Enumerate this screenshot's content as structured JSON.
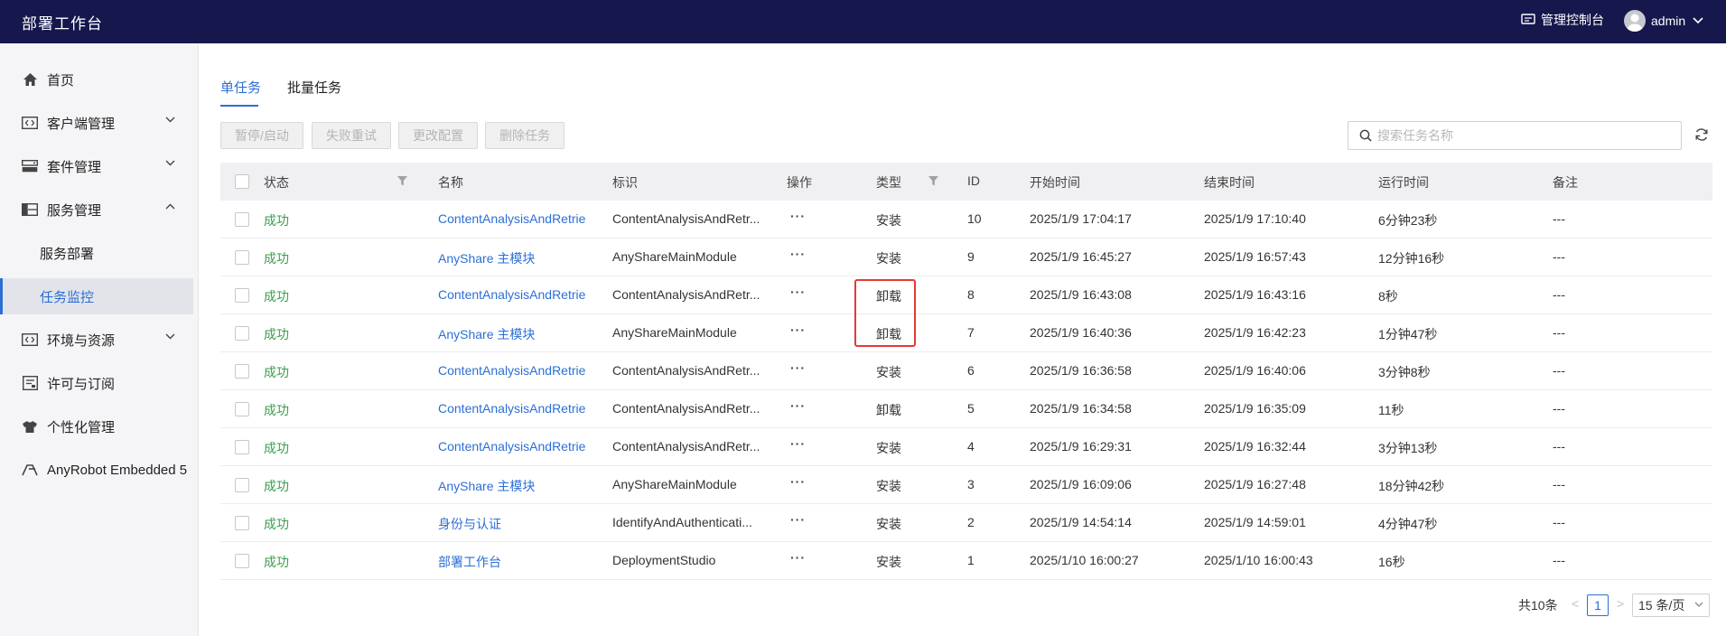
{
  "app": {
    "title": "部署工作台"
  },
  "header": {
    "console_label": "管理控制台",
    "user_name": "admin"
  },
  "sidebar": {
    "items": [
      {
        "label": "首页",
        "icon": "home-icon"
      },
      {
        "label": "客户端管理",
        "icon": "code-icon"
      },
      {
        "label": "套件管理",
        "icon": "server-icon"
      },
      {
        "label": "服务管理",
        "icon": "grid-icon"
      },
      {
        "label": "服务部署"
      },
      {
        "label": "任务监控"
      },
      {
        "label": "环境与资源",
        "icon": "code-icon"
      },
      {
        "label": "许可与订阅",
        "icon": "license-icon"
      },
      {
        "label": "个性化管理",
        "icon": "shirt-icon"
      },
      {
        "label": "AnyRobot Embedded 5",
        "icon": "anyrobot-icon"
      }
    ]
  },
  "tabs": [
    {
      "label": "单任务"
    },
    {
      "label": "批量任务"
    }
  ],
  "toolbar": {
    "pause_label": "暂停/启动",
    "retry_label": "失败重试",
    "change_label": "更改配置",
    "delete_label": "删除任务"
  },
  "search": {
    "placeholder": "搜索任务名称"
  },
  "table": {
    "headers": {
      "status": "状态",
      "name": "名称",
      "tag": "标识",
      "op": "操作",
      "type": "类型",
      "id": "ID",
      "start": "开始时间",
      "end": "结束时间",
      "duration": "运行时间",
      "note": "备注"
    },
    "rows": [
      {
        "status": "成功",
        "name": "ContentAnalysisAndRetrie",
        "tag": "ContentAnalysisAndRetr...",
        "op": "···",
        "type": "安装",
        "id": "10",
        "start": "2025/1/9 17:04:17",
        "end": "2025/1/9 17:10:40",
        "duration": "6分钟23秒",
        "note": "---"
      },
      {
        "status": "成功",
        "name": "AnyShare 主模块",
        "tag": "AnyShareMainModule",
        "op": "···",
        "type": "安装",
        "id": "9",
        "start": "2025/1/9 16:45:27",
        "end": "2025/1/9 16:57:43",
        "duration": "12分钟16秒",
        "note": "---"
      },
      {
        "status": "成功",
        "name": "ContentAnalysisAndRetrie",
        "tag": "ContentAnalysisAndRetr...",
        "op": "···",
        "type": "卸载",
        "id": "8",
        "start": "2025/1/9 16:43:08",
        "end": "2025/1/9 16:43:16",
        "duration": "8秒",
        "note": "---"
      },
      {
        "status": "成功",
        "name": "AnyShare 主模块",
        "tag": "AnyShareMainModule",
        "op": "···",
        "type": "卸载",
        "id": "7",
        "start": "2025/1/9 16:40:36",
        "end": "2025/1/9 16:42:23",
        "duration": "1分钟47秒",
        "note": "---"
      },
      {
        "status": "成功",
        "name": "ContentAnalysisAndRetrie",
        "tag": "ContentAnalysisAndRetr...",
        "op": "···",
        "type": "安装",
        "id": "6",
        "start": "2025/1/9 16:36:58",
        "end": "2025/1/9 16:40:06",
        "duration": "3分钟8秒",
        "note": "---"
      },
      {
        "status": "成功",
        "name": "ContentAnalysisAndRetrie",
        "tag": "ContentAnalysisAndRetr...",
        "op": "···",
        "type": "卸载",
        "id": "5",
        "start": "2025/1/9 16:34:58",
        "end": "2025/1/9 16:35:09",
        "duration": "11秒",
        "note": "---"
      },
      {
        "status": "成功",
        "name": "ContentAnalysisAndRetrie",
        "tag": "ContentAnalysisAndRetr...",
        "op": "···",
        "type": "安装",
        "id": "4",
        "start": "2025/1/9 16:29:31",
        "end": "2025/1/9 16:32:44",
        "duration": "3分钟13秒",
        "note": "---"
      },
      {
        "status": "成功",
        "name": "AnyShare 主模块",
        "tag": "AnyShareMainModule",
        "op": "···",
        "type": "安装",
        "id": "3",
        "start": "2025/1/9 16:09:06",
        "end": "2025/1/9 16:27:48",
        "duration": "18分钟42秒",
        "note": "---"
      },
      {
        "status": "成功",
        "name": "身份与认证",
        "tag": "IdentifyAndAuthenticati...",
        "op": "···",
        "type": "安装",
        "id": "2",
        "start": "2025/1/9 14:54:14",
        "end": "2025/1/9 14:59:01",
        "duration": "4分钟47秒",
        "note": "---"
      },
      {
        "status": "成功",
        "name": "部署工作台",
        "tag": "DeploymentStudio",
        "op": "···",
        "type": "安装",
        "id": "1",
        "start": "2025/1/10 16:00:27",
        "end": "2025/1/10 16:00:43",
        "duration": "16秒",
        "note": "---"
      }
    ]
  },
  "pagination": {
    "total_label": "共10条",
    "prev": "<",
    "current_page": "1",
    "next": ">",
    "page_size_label": "15 条/页"
  },
  "colors": {
    "header_bg": "#16174d",
    "accent": "#2b6fd6",
    "success": "#3a9e4c",
    "highlight": "#e53935"
  }
}
